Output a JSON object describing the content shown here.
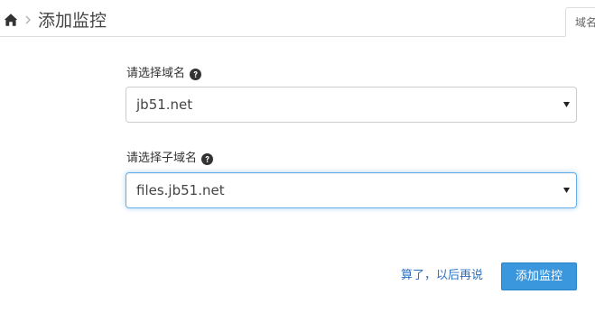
{
  "header": {
    "home_icon": "home-icon",
    "separator_icon": "chevron-right-icon",
    "title": "添加监控"
  },
  "side_tab": {
    "label": "域名"
  },
  "form": {
    "domain": {
      "label": "请选择域名",
      "help_icon": "question-circle-icon",
      "selected": "jb51.net"
    },
    "subdomain": {
      "label": "请选择子域名",
      "help_icon": "question-circle-icon",
      "selected": "files.jb51.net",
      "focused": true
    }
  },
  "actions": {
    "later_label": "算了，以后再说",
    "submit_label": "添加监控"
  },
  "colors": {
    "link": "#2a6fbf",
    "primary_button": "#3a97dd",
    "focus_border": "#66afe9"
  }
}
